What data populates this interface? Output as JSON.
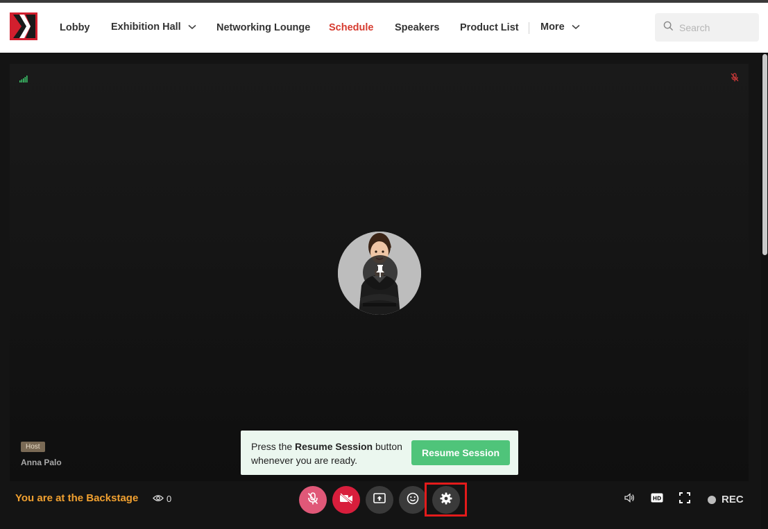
{
  "header": {
    "nav": [
      {
        "label": "Lobby"
      },
      {
        "label": "Exhibition Hall"
      },
      {
        "label": "Networking Lounge"
      },
      {
        "label": "Schedule"
      },
      {
        "label": "Speakers"
      },
      {
        "label": "Product List"
      },
      {
        "label": "More"
      }
    ],
    "active_nav": "Schedule",
    "search": {
      "placeholder": "Search"
    }
  },
  "stage": {
    "host_badge": "Host",
    "host_name": "Anna Palo"
  },
  "banner": {
    "text_before": "Press the ",
    "text_bold": "Resume Session",
    "text_after": " button whenever you are ready.",
    "button_label": "Resume Session"
  },
  "bottom": {
    "status_text": "You are at the Backstage",
    "viewer_count": "0",
    "rec_label": "REC"
  },
  "colors": {
    "brand": "#d21f2e",
    "active_nav": "#d63b2f",
    "backstage_text": "#f0a030",
    "resume_button": "#4fc47a",
    "mic_muted": "#e05878",
    "cam_off": "#d81e3c",
    "highlight_box": "#e31b1b"
  }
}
